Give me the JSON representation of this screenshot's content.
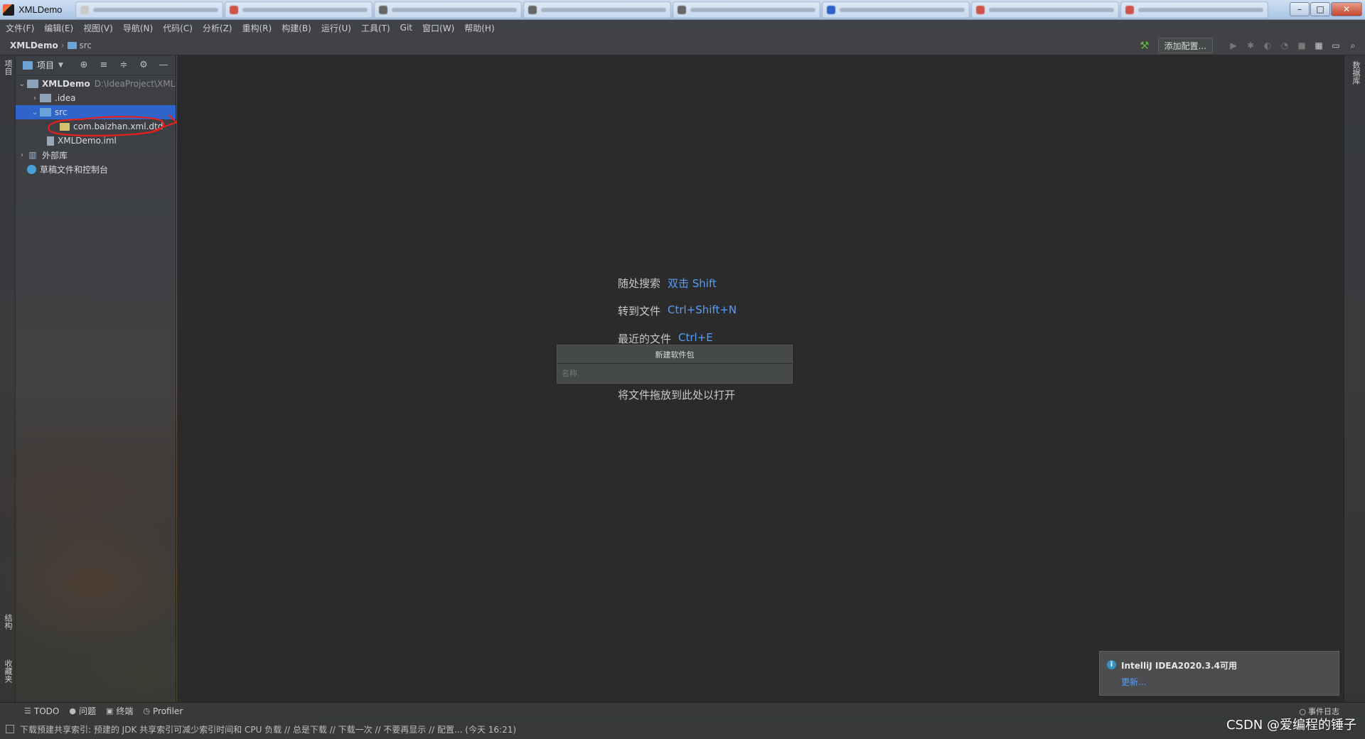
{
  "window": {
    "title": "XMLDemo"
  },
  "menu": [
    "文件(F)",
    "编辑(E)",
    "视图(V)",
    "导航(N)",
    "代码(C)",
    "分析(Z)",
    "重构(R)",
    "构建(B)",
    "运行(U)",
    "工具(T)",
    "Git",
    "窗口(W)",
    "帮助(H)"
  ],
  "breadcrumb": {
    "project": "XMLDemo",
    "folder": "src"
  },
  "toolbar": {
    "add_config": "添加配置..."
  },
  "left_strip": {
    "project": "项目",
    "structure": "结构",
    "favorites": "收藏夹"
  },
  "right_strip": {
    "database": "数据库"
  },
  "project_panel": {
    "view_label": "项目",
    "tree": [
      {
        "label": "XMLDemo",
        "hint": "D:\\IdeaProject\\XML",
        "icon": "project-folder-icon"
      },
      {
        "label": ".idea",
        "icon": "folder-icon"
      },
      {
        "label": "src",
        "icon": "source-folder-icon"
      },
      {
        "label": "com.baizhan.xml.dtd",
        "icon": "package-icon"
      },
      {
        "label": "XMLDemo.iml",
        "icon": "iml-file-icon"
      },
      {
        "label": "外部库",
        "icon": "library-icon"
      },
      {
        "label": "草稿文件和控制台",
        "icon": "scratch-icon"
      }
    ]
  },
  "editor": {
    "hints": [
      {
        "text": "随处搜索",
        "key": "双击 Shift"
      },
      {
        "text": "转到文件",
        "key": "Ctrl+Shift+N"
      },
      {
        "text": "最近的文件",
        "key": "Ctrl+E"
      }
    ],
    "drop_hint": "将文件拖放到此处以打开"
  },
  "popup": {
    "title": "新建软件包",
    "placeholder": "名称"
  },
  "notification": {
    "title": "IntelliJ IDEA2020.3.4可用",
    "link": "更新..."
  },
  "bottom_tools": [
    "TODO",
    "问题",
    "终端",
    "Profiler"
  ],
  "event_log": "事件日志",
  "status": {
    "text": "下载预建共享索引: 预建的 JDK 共享索引可减少索引时间和 CPU 负载 // 总是下载 // 下载一次 // 不要再显示 // 配置... (今天 16:21)"
  },
  "watermark": "CSDN @爱编程的锤子",
  "colors": {
    "selection": "#2f65ca",
    "link": "#589df6",
    "editor_bg": "#2b2b2b",
    "annotation": "#e8201c"
  }
}
